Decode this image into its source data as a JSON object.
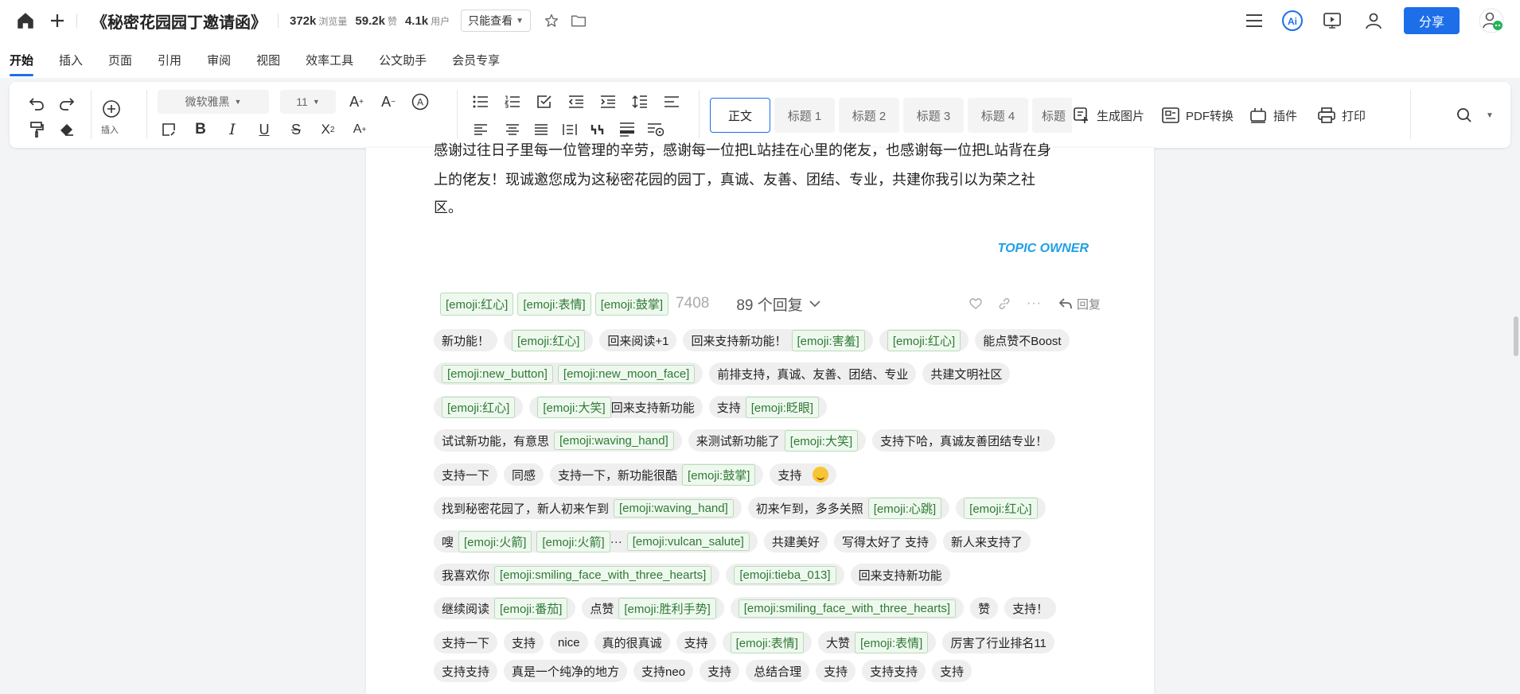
{
  "header": {
    "title": "《秘密花园园丁邀请函》",
    "stats": [
      {
        "value": "372k",
        "label": "浏览量"
      },
      {
        "value": "59.2k",
        "label": "赞"
      },
      {
        "value": "4.1k",
        "label": "用户"
      }
    ],
    "permission": "只能查看",
    "share_label": "分享"
  },
  "menu": {
    "tabs": [
      "开始",
      "插入",
      "页面",
      "引用",
      "审阅",
      "视图",
      "效率工具",
      "公文助手",
      "会员专享"
    ],
    "active": "开始"
  },
  "toolbar": {
    "font_name": "微软雅黑",
    "font_size": "11",
    "insert_label": "插入",
    "styles": [
      "正文",
      "标题 1",
      "标题 2",
      "标题 3",
      "标题 4",
      "标题"
    ],
    "tools": [
      "生成图片",
      "PDF转换",
      "插件",
      "打印"
    ]
  },
  "document": {
    "para_lines": [
      "感谢过往日子里每一位管理的辛劳，感谢每一位把L站挂在心里的佬友，也感谢每一位把L站背在身",
      "上的佬友！现诚邀您成为这秘密花园的园丁，真诚、友善、团结、专业，共建你我引以为荣之社",
      "区。"
    ],
    "topic_owner": "TOPIC OWNER",
    "reactions": [
      "[emoji:红心]",
      "[emoji:表情]",
      "[emoji:鼓掌]"
    ],
    "reaction_count": "7408",
    "reply_count": "89 个回复",
    "reply_label": "回复",
    "chip_rows": [
      [
        {
          "parts": [
            {
              "t": "新功能！"
            }
          ]
        },
        {
          "parts": [
            {
              "e": "[emoji:红心]"
            }
          ]
        },
        {
          "parts": [
            {
              "t": "回来阅读+1"
            }
          ]
        },
        {
          "parts": [
            {
              "t": "回来支持新功能！"
            },
            {
              "e": "[emoji:害羞]"
            }
          ]
        },
        {
          "parts": [
            {
              "e": "[emoji:红心]"
            }
          ]
        },
        {
          "parts": [
            {
              "t": "能点赞不Boost"
            }
          ]
        }
      ],
      [
        {
          "parts": [
            {
              "e": "[emoji:new_button]"
            },
            {
              "e": "[emoji:new_moon_face]"
            }
          ]
        },
        {
          "parts": [
            {
              "t": "前排支持，真诚、友善、团结、专业"
            }
          ]
        },
        {
          "parts": [
            {
              "t": "共建文明社区"
            }
          ]
        }
      ],
      [
        {
          "parts": [
            {
              "e": "[emoji:红心]"
            }
          ]
        },
        {
          "parts": [
            {
              "e": "[emoji:大笑]"
            },
            {
              "t": "回来支持新功能"
            }
          ]
        },
        {
          "parts": [
            {
              "t": "支持"
            },
            {
              "e": "[emoji:眨眼]"
            }
          ]
        }
      ],
      [
        {
          "parts": [
            {
              "t": "试试新功能，有意思"
            },
            {
              "e": "[emoji:waving_hand]"
            }
          ]
        },
        {
          "parts": [
            {
              "t": "来测试新功能了"
            },
            {
              "e": "[emoji:大笑]"
            }
          ]
        },
        {
          "parts": [
            {
              "t": "支持下哈，真诚友善团结专业！"
            }
          ]
        }
      ],
      [
        {
          "parts": [
            {
              "t": "支持一下"
            }
          ]
        },
        {
          "parts": [
            {
              "t": "同感"
            }
          ]
        },
        {
          "parts": [
            {
              "t": "支持一下，新功能很酷"
            },
            {
              "e": "[emoji:鼓掌]"
            }
          ]
        },
        {
          "parts": [
            {
              "t": "支持"
            },
            {
              "s": "smile"
            }
          ]
        }
      ],
      [
        {
          "parts": [
            {
              "t": "找到秘密花园了，新人初来乍到"
            },
            {
              "e": "[emoji:waving_hand]"
            }
          ]
        },
        {
          "parts": [
            {
              "t": "初来乍到，多多关照"
            },
            {
              "e": "[emoji:心跳]"
            }
          ]
        },
        {
          "parts": [
            {
              "e": "[emoji:红心]"
            }
          ]
        }
      ],
      [
        {
          "parts": [
            {
              "t": "嗖"
            },
            {
              "e": "[emoji:火箭]"
            },
            {
              "e": "[emoji:火箭]"
            },
            {
              "t": "···"
            },
            {
              "e": "[emoji:vulcan_salute]"
            }
          ]
        },
        {
          "parts": [
            {
              "t": "共建美好"
            }
          ]
        },
        {
          "parts": [
            {
              "t": "写得太好了 支持"
            }
          ]
        },
        {
          "parts": [
            {
              "t": "新人来支持了"
            }
          ]
        }
      ],
      [
        {
          "parts": [
            {
              "t": "我喜欢你"
            },
            {
              "e": "[emoji:smiling_face_with_three_hearts]"
            }
          ]
        },
        {
          "parts": [
            {
              "e": "[emoji:tieba_013]"
            }
          ]
        },
        {
          "parts": [
            {
              "t": "回来支持新功能"
            }
          ]
        }
      ],
      [
        {
          "parts": [
            {
              "t": "继续阅读"
            },
            {
              "e": "[emoji:番茄]"
            }
          ]
        },
        {
          "parts": [
            {
              "t": "点赞"
            },
            {
              "e": "[emoji:胜利手势]"
            }
          ]
        },
        {
          "parts": [
            {
              "e": "[emoji:smiling_face_with_three_hearts]"
            }
          ]
        },
        {
          "parts": [
            {
              "t": "赞"
            }
          ]
        },
        {
          "parts": [
            {
              "t": "支持！"
            }
          ]
        }
      ],
      [
        {
          "parts": [
            {
              "t": "支持一下"
            }
          ]
        },
        {
          "parts": [
            {
              "t": "支持"
            }
          ]
        },
        {
          "parts": [
            {
              "t": "nice"
            }
          ]
        },
        {
          "parts": [
            {
              "t": "真的很真诚"
            }
          ]
        },
        {
          "parts": [
            {
              "t": "支持"
            }
          ]
        },
        {
          "parts": [
            {
              "e": "[emoji:表情]"
            }
          ]
        },
        {
          "parts": [
            {
              "t": "大赞"
            },
            {
              "e": "[emoji:表情]"
            }
          ]
        },
        {
          "parts": [
            {
              "t": "厉害了行业排名11"
            }
          ]
        }
      ],
      [
        {
          "parts": [
            {
              "t": "支持支持"
            }
          ]
        },
        {
          "parts": [
            {
              "t": "真是一个纯净的地方"
            }
          ]
        },
        {
          "parts": [
            {
              "t": "支持neo"
            }
          ]
        },
        {
          "parts": [
            {
              "t": "支持"
            }
          ]
        },
        {
          "parts": [
            {
              "t": "总结合理"
            }
          ]
        },
        {
          "parts": [
            {
              "t": "支持"
            }
          ]
        },
        {
          "parts": [
            {
              "t": "支持支持"
            }
          ]
        },
        {
          "parts": [
            {
              "t": "支持"
            }
          ]
        }
      ]
    ]
  }
}
